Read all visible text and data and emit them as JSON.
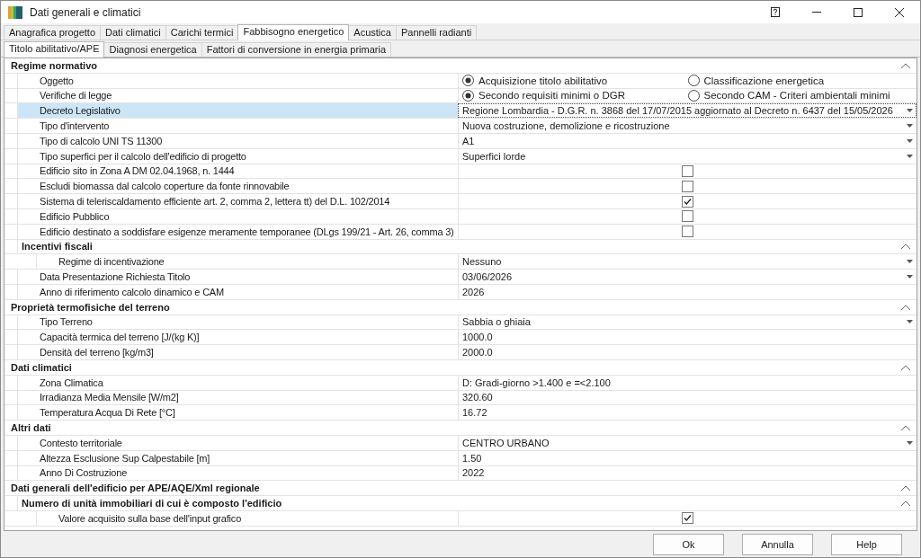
{
  "window": {
    "title": "Dati generali e climatici"
  },
  "tabs": [
    {
      "label": "Anagrafica progetto",
      "selected": false
    },
    {
      "label": "Dati climatici",
      "selected": false
    },
    {
      "label": "Carichi termici",
      "selected": false
    },
    {
      "label": "Fabbisogno energetico",
      "selected": true
    },
    {
      "label": "Acustica",
      "selected": false
    },
    {
      "label": "Pannelli radianti",
      "selected": false
    }
  ],
  "subtabs": [
    {
      "label": "Titolo abilitativo/APE",
      "selected": true
    },
    {
      "label": "Diagnosi energetica",
      "selected": false
    },
    {
      "label": "Fattori di conversione in energia primaria",
      "selected": false
    }
  ],
  "sections": [
    {
      "title": "Regime normativo",
      "expanded": true,
      "rows": [
        {
          "kind": "radio",
          "label": "Oggetto",
          "selected": false,
          "options": [
            {
              "label": "Acquisizione titolo abilitativo",
              "selected": true
            },
            {
              "label": "Classificazione energetica",
              "selected": false
            }
          ]
        },
        {
          "kind": "radio",
          "label": "Verifiche di legge",
          "selected": false,
          "options": [
            {
              "label": "Secondo requisiti minimi o DGR",
              "selected": true
            },
            {
              "label": "Secondo CAM - Criteri ambientali minimi",
              "selected": false
            }
          ]
        },
        {
          "kind": "dropdown",
          "label": "Decreto Legislativo",
          "value": "Regione Lombardia - D.G.R. n. 3868 del 17/07/2015 aggiornato al Decreto n. 6437 del 15/05/2026",
          "selected": true
        },
        {
          "kind": "dropdown",
          "label": "Tipo d'intervento",
          "value": "Nuova costruzione, demolizione e ricostruzione",
          "selected": false
        },
        {
          "kind": "dropdown",
          "label": "Tipo di calcolo UNI TS 11300",
          "value": "A1",
          "selected": false
        },
        {
          "kind": "dropdown",
          "label": "Tipo superfici per il calcolo dell'edificio di progetto",
          "value": "Superfici lorde",
          "selected": false
        },
        {
          "kind": "checkbox",
          "label": "Edificio sito in Zona A DM 02.04.1968, n. 1444",
          "checked": false,
          "selected": false
        },
        {
          "kind": "checkbox",
          "label": "Escludi biomassa dal calcolo coperture da fonte rinnovabile",
          "checked": false,
          "selected": false
        },
        {
          "kind": "checkbox",
          "label": "Sistema di teleriscaldamento efficiente art. 2, comma 2, lettera tt) del D.L. 102/2014",
          "checked": true,
          "selected": false
        },
        {
          "kind": "checkbox",
          "label": "Edificio Pubblico",
          "checked": false,
          "selected": false
        },
        {
          "kind": "checkbox",
          "label": "Edificio destinato a soddisfare esigenze meramente temporanee (DLgs 199/21 - Art. 26, comma 3)",
          "checked": false,
          "selected": false
        },
        {
          "kind": "group",
          "label": "Incentivi fiscali",
          "expanded": true,
          "children": [
            {
              "kind": "dropdown",
              "label": "Regime di incentivazione",
              "value": "Nessuno",
              "selected": false
            }
          ]
        },
        {
          "kind": "dropdown",
          "label": "Data Presentazione Richiesta Titolo",
          "value": "03/06/2026",
          "selected": false
        },
        {
          "kind": "text",
          "label": "Anno di riferimento calcolo dinamico e CAM",
          "value": "2026",
          "selected": false
        }
      ]
    },
    {
      "title": "Proprietà termofisiche del terreno",
      "expanded": true,
      "rows": [
        {
          "kind": "dropdown",
          "label": "Tipo Terreno",
          "value": "Sabbia o ghiaia",
          "selected": false
        },
        {
          "kind": "text",
          "label": "Capacità termica del terreno [J/(kg K)]",
          "value": "1000.0",
          "selected": false
        },
        {
          "kind": "text",
          "label": "Densità del terreno [kg/m3]",
          "value": "2000.0",
          "selected": false
        }
      ]
    },
    {
      "title": "Dati climatici",
      "expanded": true,
      "rows": [
        {
          "kind": "text",
          "label": "Zona Climatica",
          "value": "D: Gradi-giorno >1.400 e  =<2.100",
          "selected": false
        },
        {
          "kind": "text",
          "label": "Irradianza Media Mensile [W/m2]",
          "value": "320.60",
          "selected": false
        },
        {
          "kind": "text",
          "label": "Temperatura Acqua Di Rete [°C]",
          "value": "16.72",
          "selected": false
        }
      ]
    },
    {
      "title": "Altri dati",
      "expanded": true,
      "rows": [
        {
          "kind": "dropdown",
          "label": "Contesto territoriale",
          "value": "CENTRO URBANO",
          "selected": false
        },
        {
          "kind": "text",
          "label": "Altezza Esclusione Sup Calpestabile [m]",
          "value": "1.50",
          "selected": false
        },
        {
          "kind": "text",
          "label": "Anno Di Costruzione",
          "value": "2022",
          "selected": false
        }
      ]
    },
    {
      "title": "Dati generali dell'edificio per APE/AQE/Xml regionale",
      "expanded": true,
      "rows": [
        {
          "kind": "group",
          "label": "Numero di unità immobiliari di cui è composto l'edificio",
          "expanded": true,
          "children": [
            {
              "kind": "checkbox",
              "label": "Valore acquisito sulla base dell'input grafico",
              "checked": true,
              "selected": false
            }
          ]
        }
      ]
    }
  ],
  "buttons": [
    "Ok",
    "Annulla",
    "Help"
  ]
}
